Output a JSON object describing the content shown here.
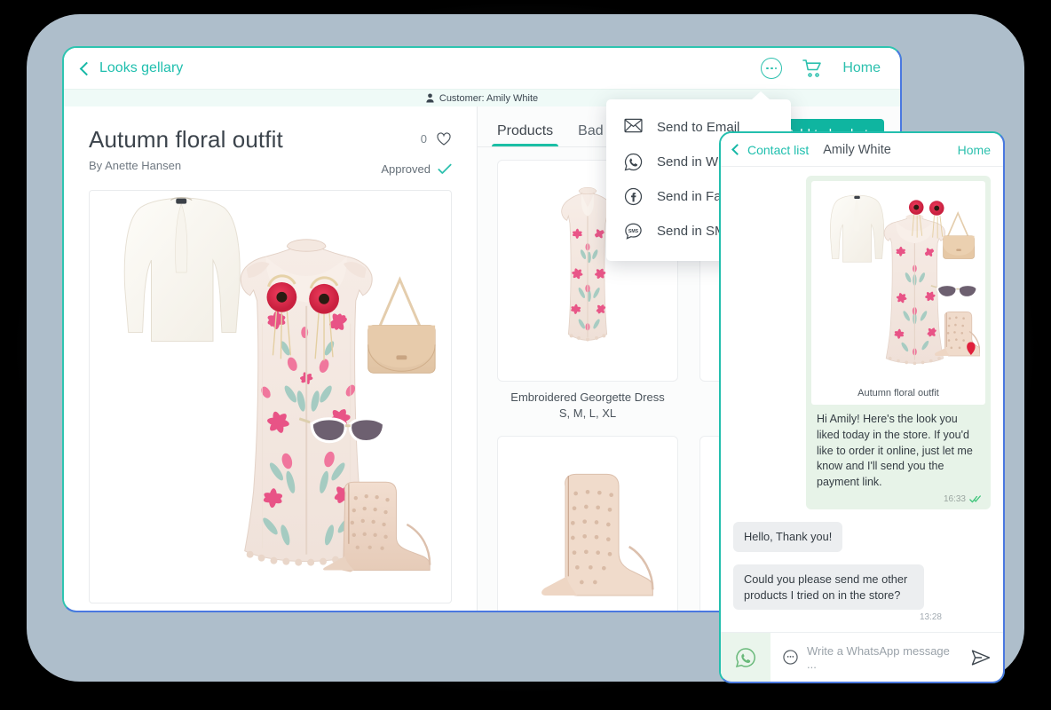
{
  "tablet": {
    "topbar": {
      "back_label": "Looks gellary",
      "home_label": "Home",
      "more_icon": "more-dots-icon",
      "cart_icon": "shopping-cart-icon"
    },
    "customer_strip": {
      "text": "Customer: Amily White",
      "icon": "person-icon"
    },
    "look": {
      "title": "Autumn floral outfit",
      "author": "By Anette Hansen",
      "like_count": "0",
      "like_icon": "heart-icon",
      "status": "Approved",
      "status_icon": "check-icon"
    },
    "tabs": [
      {
        "label": "Products",
        "active": true
      },
      {
        "label": "Bad",
        "active": false
      }
    ],
    "basket_button": "Add to basket",
    "products": [
      {
        "name": "Embroidered Georgette Dress",
        "sizes": "S, M, L, XL"
      },
      {
        "name": "",
        "sizes": ""
      },
      {
        "name": "",
        "sizes": ""
      },
      {
        "name": "",
        "sizes": ""
      }
    ]
  },
  "share_menu": {
    "items": [
      {
        "label": "Send to Email",
        "icon": "envelope-icon"
      },
      {
        "label": "Send in Wh",
        "icon": "whatsapp-icon"
      },
      {
        "label": "Send in Fa",
        "icon": "facebook-icon"
      },
      {
        "label": "Send in SM",
        "icon": "sms-icon"
      }
    ]
  },
  "phone": {
    "topbar": {
      "back_label": "Contact list",
      "contact_name": "Amily White",
      "home_label": "Home"
    },
    "messages": [
      {
        "direction": "out",
        "type": "image",
        "caption": "Autumn floral outfit",
        "text": "Hi Amily! Here's the look you liked today in the store. If you'd like to order it online, just let me know and I'll send you the payment link.",
        "time": "16:33",
        "status_icon": "double-check-icon"
      },
      {
        "direction": "in",
        "type": "text",
        "text": "Hello, Thank you!",
        "time": ""
      },
      {
        "direction": "in",
        "type": "text",
        "text": "Could you please send me other products I tried on in the store?",
        "time": "13:28"
      }
    ],
    "input": {
      "placeholder": "Write a WhatsApp message ...",
      "whatsapp_icon": "whatsapp-icon",
      "emoji_icon": "emoji-icon",
      "send_icon": "send-icon"
    }
  },
  "colors": {
    "teal": "#1fbfae",
    "teal_dark": "#0fb5a0",
    "blue_border": "#4a78e0",
    "plate": "#aebecb",
    "bubble_out": "#e7f3e8",
    "bubble_in": "#eceef0",
    "background": "#000000"
  }
}
